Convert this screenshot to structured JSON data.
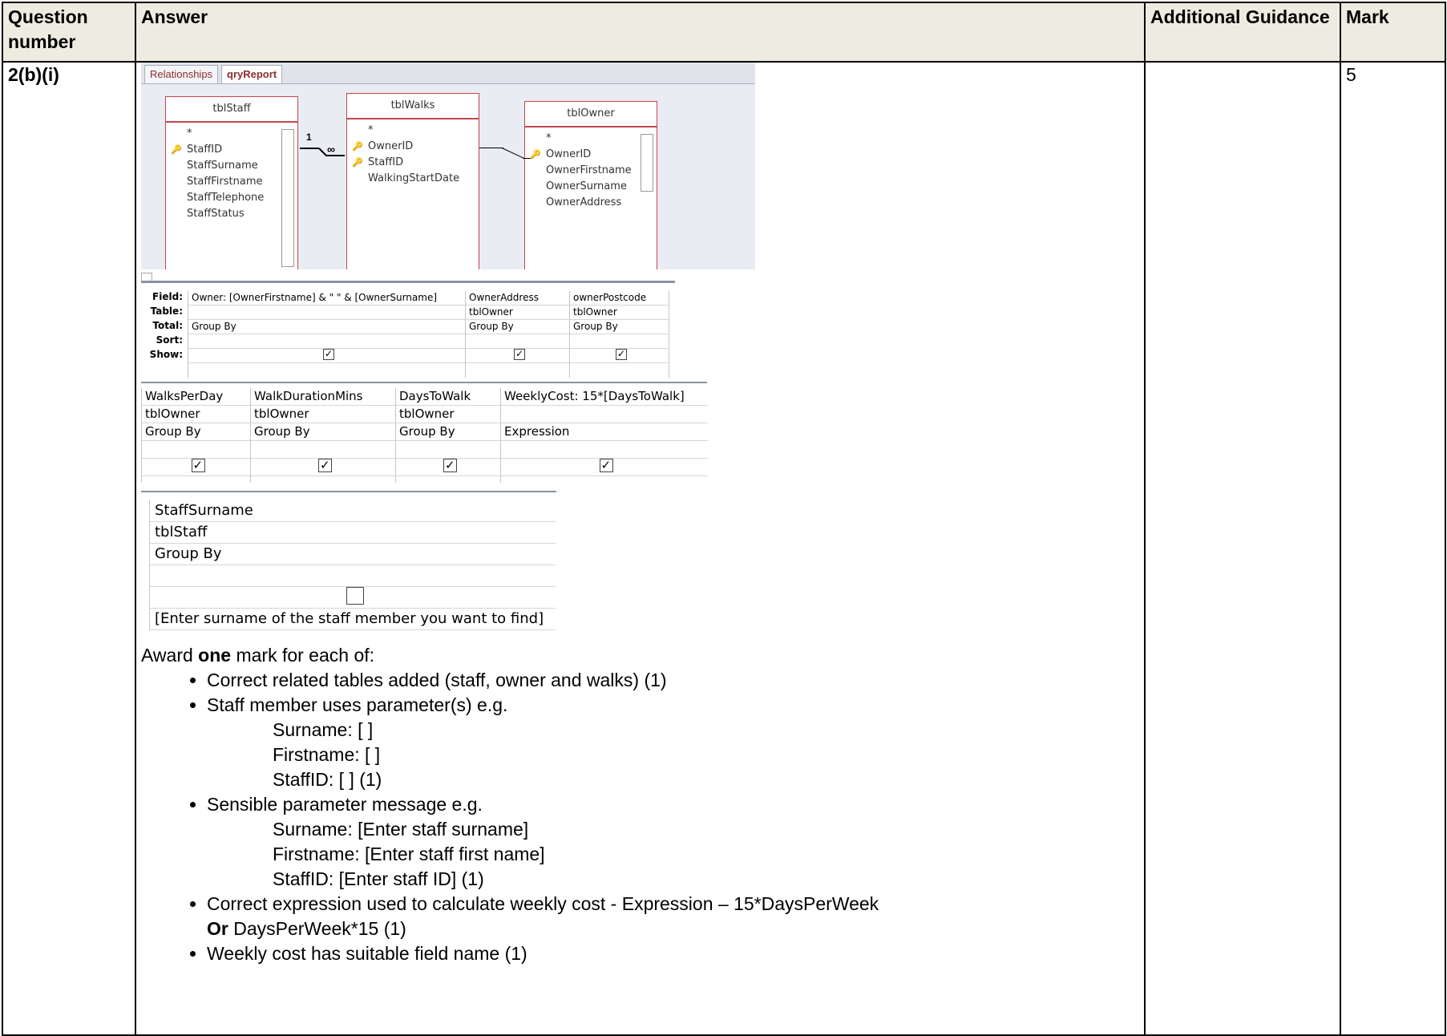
{
  "headers": {
    "question": "Question number",
    "answer": "Answer",
    "guidance": "Additional Guidance",
    "mark": "Mark"
  },
  "row": {
    "question": "2(b)(i)",
    "mark": "5"
  },
  "access": {
    "tabs": [
      "Relationships",
      "qryReport"
    ],
    "tables": [
      {
        "name": "tblStaff",
        "fields": [
          "*",
          "StaffID",
          "StaffSurname",
          "StaffFirstname",
          "StaffTelephone",
          "StaffStatus"
        ]
      },
      {
        "name": "tblWalks",
        "fields": [
          "*",
          "OwnerID",
          "StaffID",
          "WalkingStartDate"
        ]
      },
      {
        "name": "tblOwner",
        "fields": [
          "*",
          "OwnerID",
          "OwnerFirstname",
          "OwnerSurname",
          "OwnerAddress"
        ]
      }
    ],
    "rel_one": "1",
    "rel_many": "∞",
    "grid1": {
      "labels": [
        "Field:",
        "Table:",
        "Total:",
        "Sort:",
        "Show:"
      ],
      "columns": [
        {
          "field": "Owner: [OwnerFirstname] & \" \" & [OwnerSurname]",
          "table": "",
          "total": "Group By"
        },
        {
          "field": "OwnerAddress",
          "table": "tblOwner",
          "total": "Group By"
        },
        {
          "field": "ownerPostcode",
          "table": "tblOwner",
          "total": "Group By"
        }
      ]
    },
    "grid2": {
      "columns": [
        {
          "field": "WalksPerDay",
          "table": "tblOwner",
          "total": "Group By"
        },
        {
          "field": "WalkDurationMins",
          "table": "tblOwner",
          "total": "Group By"
        },
        {
          "field": "DaysToWalk",
          "table": "tblOwner",
          "total": "Group By"
        },
        {
          "field": "WeeklyCost: 15*[DaysToWalk]",
          "table": "",
          "total": "Expression"
        }
      ]
    },
    "grid3": {
      "field": "StaffSurname",
      "table": "tblStaff",
      "total": "Group By",
      "criteria": "[Enter surname of the staff member you want to find]"
    }
  },
  "marks": {
    "intro_pre": "Award ",
    "intro_bold": "one",
    "intro_post": " mark for each of:",
    "b1": "Correct related tables added (staff, owner and walks) (1)",
    "b2": "Staff member uses parameter(s) e.g.",
    "b2_lines": [
      "Surname:  [ ]",
      "Firstname:  [ ]",
      "StaffID: [ ] (1)"
    ],
    "b3": "Sensible parameter message e.g.",
    "b3_lines": [
      "Surname:  [Enter staff surname]",
      "Firstname:  [Enter staff first name]",
      "StaffID: [Enter staff ID] (1)"
    ],
    "b4": "Correct expression used to calculate weekly cost - Expression – 15*DaysPerWeek",
    "b4_or_bold": "Or",
    "b4_or_rest": " DaysPerWeek*15 (1)",
    "b5": "Weekly cost has suitable field name (1)"
  }
}
